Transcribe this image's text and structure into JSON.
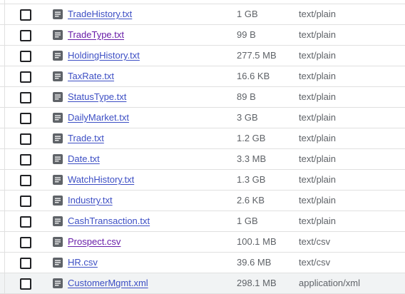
{
  "files": [
    {
      "name": "TradeHistory.txt",
      "size": "1 GB",
      "type": "text/plain",
      "icon": "document-icon",
      "visited": false
    },
    {
      "name": "TradeType.txt",
      "size": "99 B",
      "type": "text/plain",
      "icon": "document-icon",
      "visited": true
    },
    {
      "name": "HoldingHistory.txt",
      "size": "277.5 MB",
      "type": "text/plain",
      "icon": "document-icon",
      "visited": false
    },
    {
      "name": "TaxRate.txt",
      "size": "16.6 KB",
      "type": "text/plain",
      "icon": "document-icon",
      "visited": false
    },
    {
      "name": "StatusType.txt",
      "size": "89 B",
      "type": "text/plain",
      "icon": "document-icon",
      "visited": false
    },
    {
      "name": "DailyMarket.txt",
      "size": "3 GB",
      "type": "text/plain",
      "icon": "document-icon",
      "visited": false
    },
    {
      "name": "Trade.txt",
      "size": "1.2 GB",
      "type": "text/plain",
      "icon": "document-icon",
      "visited": false
    },
    {
      "name": "Date.txt",
      "size": "3.3 MB",
      "type": "text/plain",
      "icon": "document-icon",
      "visited": false
    },
    {
      "name": "WatchHistory.txt",
      "size": "1.3 GB",
      "type": "text/plain",
      "icon": "document-icon",
      "visited": false
    },
    {
      "name": "Industry.txt",
      "size": "2.6 KB",
      "type": "text/plain",
      "icon": "document-icon",
      "visited": false
    },
    {
      "name": "CashTransaction.txt",
      "size": "1 GB",
      "type": "text/plain",
      "icon": "document-icon",
      "visited": false
    },
    {
      "name": "Prospect.csv",
      "size": "100.1 MB",
      "type": "text/csv",
      "icon": "document-icon",
      "visited": true
    },
    {
      "name": "HR.csv",
      "size": "39.6 MB",
      "type": "text/csv",
      "icon": "document-icon",
      "visited": false
    },
    {
      "name": "CustomerMgmt.xml",
      "size": "298.1 MB",
      "type": "application/xml",
      "icon": "document-icon",
      "visited": false,
      "highlighted": true
    }
  ],
  "colors": {
    "link": "#3c4ec4",
    "visited_link": "#681da8",
    "secondary_text": "#5f6368",
    "icon": "#5f6368",
    "row_divider": "#e0e0e0",
    "hover_row": "#f1f3f4"
  }
}
